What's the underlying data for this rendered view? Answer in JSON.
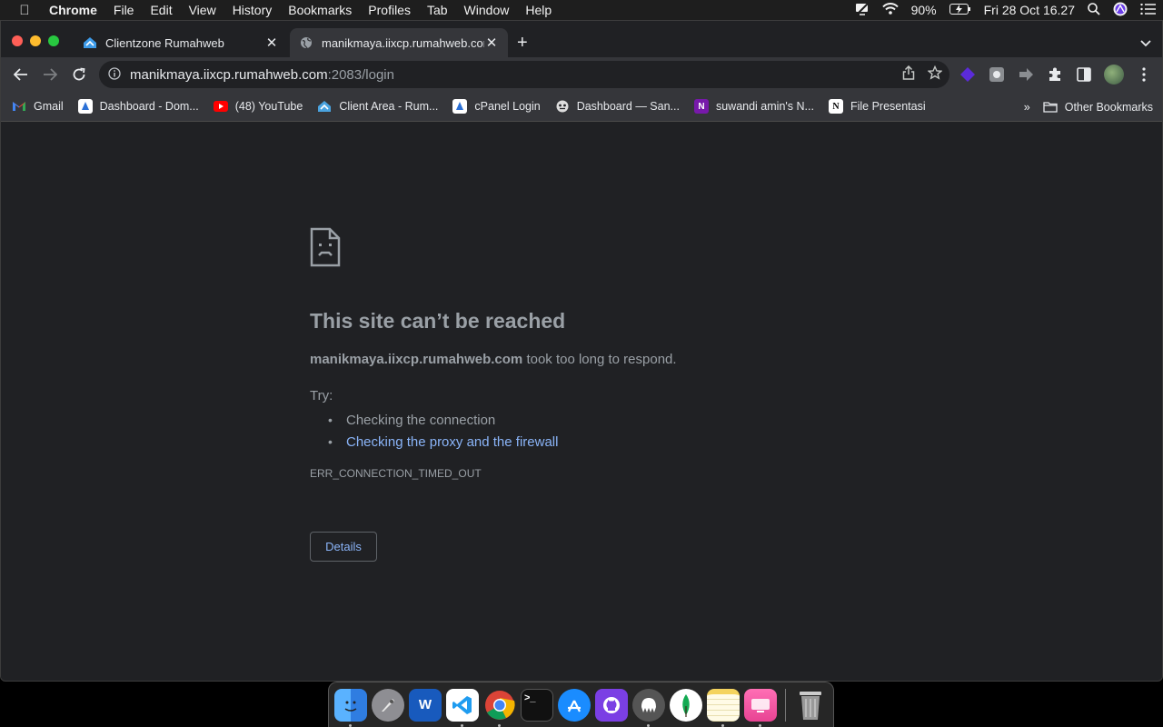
{
  "menubar": {
    "app_name": "Chrome",
    "menus": [
      "File",
      "Edit",
      "View",
      "History",
      "Bookmarks",
      "Profiles",
      "Tab",
      "Window",
      "Help"
    ],
    "battery": "90%",
    "datetime": "Fri 28 Oct  16.27"
  },
  "tabs": [
    {
      "title": "Clientzone Rumahweb",
      "active": false
    },
    {
      "title": "manikmaya.iixcp.rumahweb.com",
      "active": true
    }
  ],
  "address_bar": {
    "host": "manikmaya.iixcp.rumahweb.com",
    "path": ":2083/login"
  },
  "bookmarks": [
    {
      "label": "Gmail",
      "icon": "gmail-icon",
      "color": "#ea4335"
    },
    {
      "label": "Dashboard - Dom...",
      "icon": "dashboard-icon",
      "color": "#ffffff"
    },
    {
      "label": "(48) YouTube",
      "icon": "youtube-icon",
      "color": "#ff0000"
    },
    {
      "label": "Client Area - Rum...",
      "icon": "rumahweb-icon",
      "color": "#4aa3df"
    },
    {
      "label": "cPanel Login",
      "icon": "cpanel-icon",
      "color": "#ffffff"
    },
    {
      "label": "Dashboard — San...",
      "icon": "sanity-icon",
      "color": "#dddddd"
    },
    {
      "label": "suwandi amin's N...",
      "icon": "onenote-icon",
      "color": "#7719aa"
    },
    {
      "label": "File Presentasi",
      "icon": "notion-icon",
      "color": "#ffffff"
    }
  ],
  "other_bookmarks": "Other Bookmarks",
  "error_page": {
    "title": "This site can’t be reached",
    "host": "manikmaya.iixcp.rumahweb.com",
    "message": "took too long to respond.",
    "try_label": "Try:",
    "suggestion_1": "Checking the connection",
    "suggestion_2": "Checking the proxy and the firewall",
    "error_code": "ERR_CONNECTION_TIMED_OUT",
    "details_button": "Details"
  },
  "dock": [
    {
      "name": "finder",
      "color": "#2f7de1",
      "running": true
    },
    {
      "name": "launchpad",
      "color": "#8e8e93",
      "running": false
    },
    {
      "name": "word",
      "color": "#185abd",
      "running": false
    },
    {
      "name": "vscode",
      "color": "#1f9cf0",
      "running": true
    },
    {
      "name": "chrome",
      "color": "#34a853",
      "running": true
    },
    {
      "name": "terminal",
      "color": "#111111",
      "running": false
    },
    {
      "name": "app-store",
      "color": "#1a8cff",
      "running": false
    },
    {
      "name": "github-desktop",
      "color": "#7b3fe4",
      "running": false
    },
    {
      "name": "tableplus",
      "color": "#555555",
      "running": true
    },
    {
      "name": "mongodb-compass",
      "color": "#13aa52",
      "running": false
    },
    {
      "name": "notes",
      "color": "#f4d35e",
      "running": true
    },
    {
      "name": "ci-app",
      "color": "#e84393",
      "running": true
    },
    {
      "name": "trash",
      "color": "#777777",
      "running": false
    }
  ]
}
